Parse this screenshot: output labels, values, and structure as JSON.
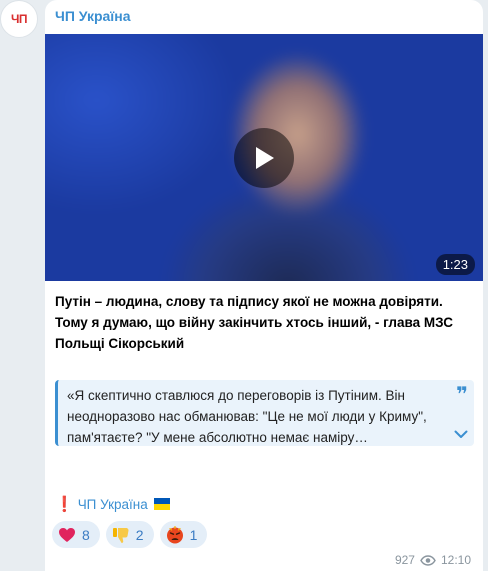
{
  "channel": {
    "avatar_text": "ЧП",
    "name": "ЧП Україна"
  },
  "video": {
    "duration": "1:23"
  },
  "post": {
    "headline": "Путін – людина, слову та підпису якої не можна довіряти. Тому я думаю, що війну закінчить хтось інший, - глава МЗС Польщі Сікорський",
    "quote": "«Я скептично ставлюся до переговорів із Путіним. Він неодноразово нас обманював: \"Це не мої люди у Криму\", пам'ятаєте? \"У мене абсолютно немає наміру…",
    "quote_mark": "❞",
    "signature_mark": "❗",
    "signature": "ЧП Україна"
  },
  "reactions": [
    {
      "icon": "heart-icon",
      "count": "8"
    },
    {
      "icon": "thumbs-down-icon",
      "count": "2"
    },
    {
      "icon": "angry-face-icon",
      "count": "1"
    }
  ],
  "meta": {
    "views": "927",
    "time": "12:10"
  },
  "colors": {
    "accent": "#3b8fd1",
    "brand_red": "#d92f2f",
    "flag_blue": "#0057b7",
    "flag_yellow": "#ffd700"
  }
}
